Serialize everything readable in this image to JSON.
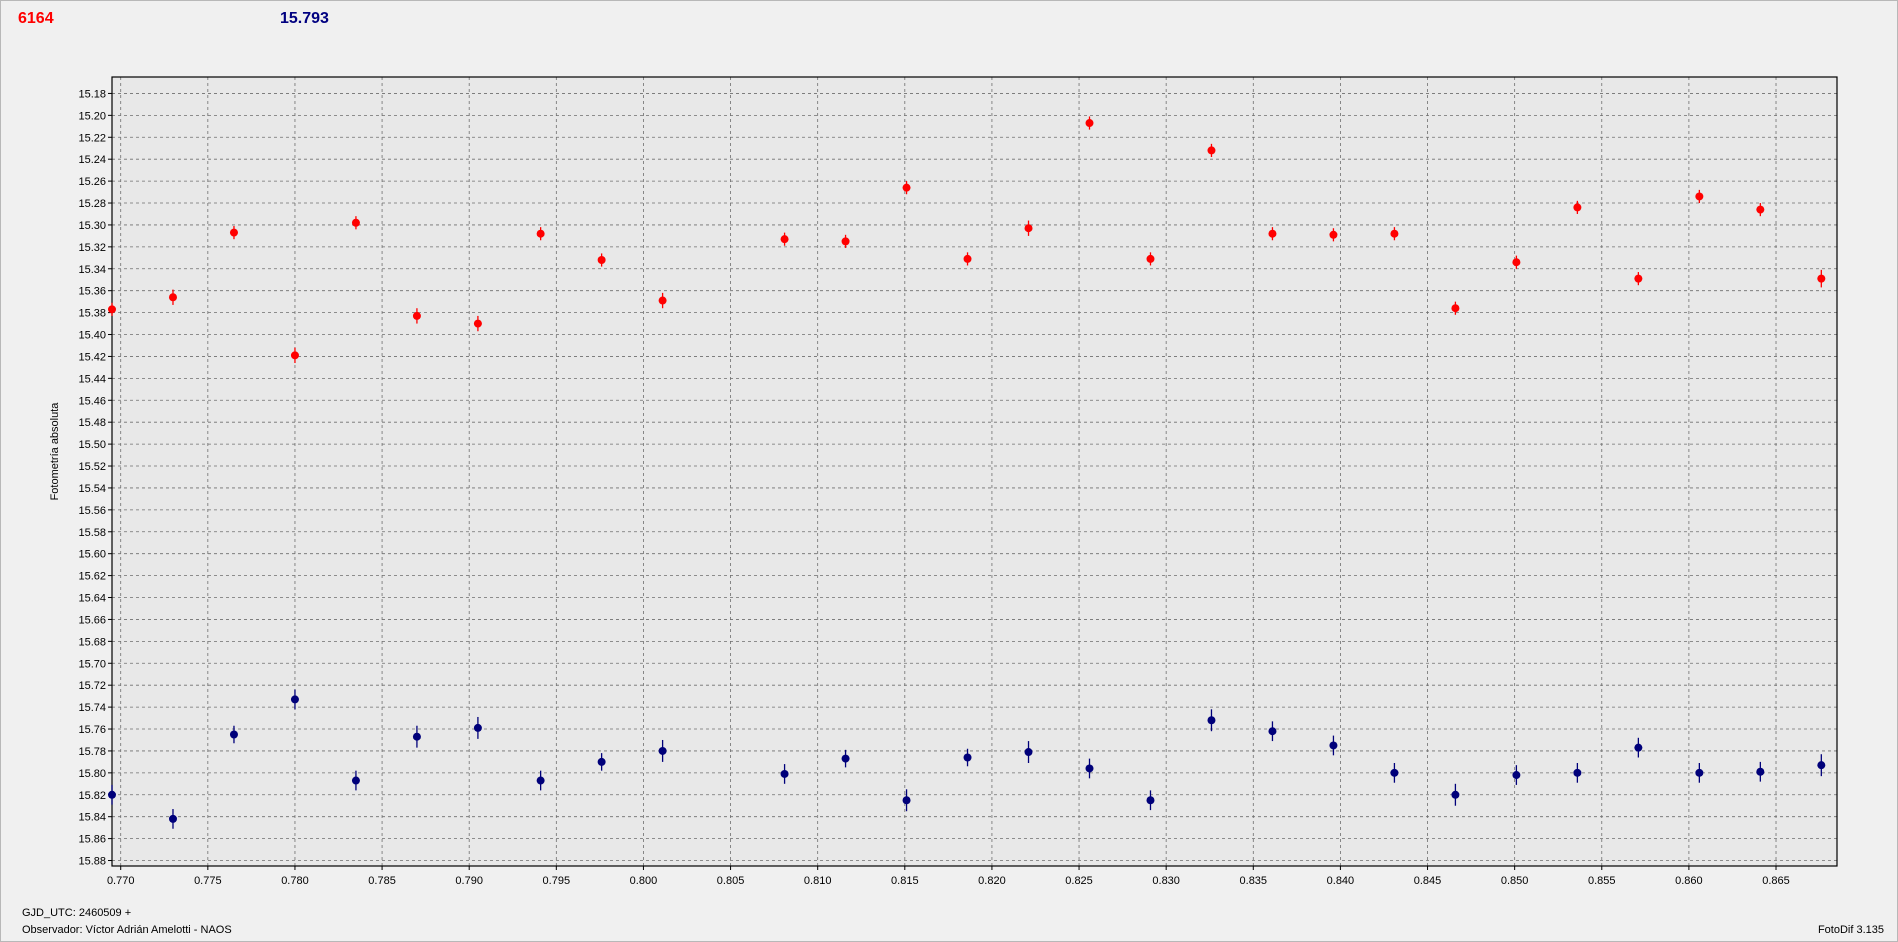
{
  "header": {
    "left_value": "6164",
    "right_value": "15.793"
  },
  "footer": {
    "gjd": "GJD_UTC: 2460509 +",
    "observer": "Observador: Víctor Adrián Amelotti - NAOS",
    "version": "FotoDif 3.135"
  },
  "colors": {
    "series_red": "#ff0000",
    "series_blue": "#00007a",
    "plot_bg": "#e8e8e8",
    "grid": "#6e6e6e"
  },
  "chart_data": {
    "type": "scatter",
    "ylabel": "Fotometría absoluta",
    "xlabel": "",
    "xlim": [
      0.7695,
      0.8685
    ],
    "ylim": [
      15.885,
      15.165
    ],
    "y_inverted": true,
    "grid": true,
    "x_ticks": [
      "0.770",
      "0.775",
      "0.780",
      "0.785",
      "0.790",
      "0.795",
      "0.800",
      "0.805",
      "0.810",
      "0.815",
      "0.820",
      "0.825",
      "0.830",
      "0.835",
      "0.840",
      "0.845",
      "0.850",
      "0.855",
      "0.860",
      "0.865"
    ],
    "y_ticks": [
      "15.18",
      "15.20",
      "15.22",
      "15.24",
      "15.26",
      "15.28",
      "15.30",
      "15.32",
      "15.34",
      "15.36",
      "15.38",
      "15.40",
      "15.42",
      "15.44",
      "15.46",
      "15.48",
      "15.50",
      "15.52",
      "15.54",
      "15.56",
      "15.58",
      "15.60",
      "15.62",
      "15.64",
      "15.66",
      "15.68",
      "15.70",
      "15.72",
      "15.74",
      "15.76",
      "15.78",
      "15.80",
      "15.82",
      "15.84",
      "15.86",
      "15.88"
    ],
    "series": [
      {
        "color": "#ff0000",
        "x": [
          0.7695,
          0.773,
          0.7765,
          0.78,
          0.7835,
          0.787,
          0.7905,
          0.7941,
          0.7976,
          0.8011,
          0.8081,
          0.8116,
          0.8151,
          0.8186,
          0.8221,
          0.8256,
          0.8291,
          0.8326,
          0.8361,
          0.8396,
          0.8431,
          0.8466,
          0.8501,
          0.8536,
          0.8571,
          0.8606,
          0.8641,
          0.8676
        ],
        "y": [
          15.377,
          15.366,
          15.307,
          15.419,
          15.298,
          15.383,
          15.39,
          15.308,
          15.332,
          15.369,
          15.313,
          15.315,
          15.266,
          15.331,
          15.303,
          15.207,
          15.331,
          15.232,
          15.308,
          15.309,
          15.308,
          15.376,
          15.334,
          15.284,
          15.349,
          15.274,
          15.286,
          15.349
        ],
        "err": [
          0.006,
          0.007,
          0.006,
          0.007,
          0.006,
          0.007,
          0.007,
          0.006,
          0.006,
          0.007,
          0.006,
          0.006,
          0.006,
          0.006,
          0.007,
          0.006,
          0.006,
          0.006,
          0.006,
          0.006,
          0.006,
          0.006,
          0.006,
          0.006,
          0.006,
          0.006,
          0.006,
          0.008
        ]
      },
      {
        "color": "#00007a",
        "x": [
          0.7695,
          0.773,
          0.7765,
          0.78,
          0.7835,
          0.787,
          0.7905,
          0.7941,
          0.7976,
          0.8011,
          0.8081,
          0.8116,
          0.8151,
          0.8186,
          0.8221,
          0.8256,
          0.8291,
          0.8326,
          0.8361,
          0.8396,
          0.8431,
          0.8466,
          0.8501,
          0.8536,
          0.8571,
          0.8606,
          0.8641,
          0.8676
        ],
        "y": [
          15.82,
          15.842,
          15.765,
          15.733,
          15.807,
          15.767,
          15.759,
          15.807,
          15.79,
          15.78,
          15.801,
          15.787,
          15.825,
          15.786,
          15.781,
          15.796,
          15.825,
          15.752,
          15.762,
          15.775,
          15.8,
          15.82,
          15.802,
          15.8,
          15.777,
          15.8,
          15.799,
          15.793
        ],
        "err": [
          0.009,
          0.009,
          0.008,
          0.009,
          0.009,
          0.01,
          0.01,
          0.009,
          0.008,
          0.01,
          0.009,
          0.008,
          0.01,
          0.008,
          0.01,
          0.009,
          0.009,
          0.01,
          0.009,
          0.009,
          0.009,
          0.01,
          0.009,
          0.009,
          0.009,
          0.009,
          0.009,
          0.01
        ]
      }
    ]
  }
}
